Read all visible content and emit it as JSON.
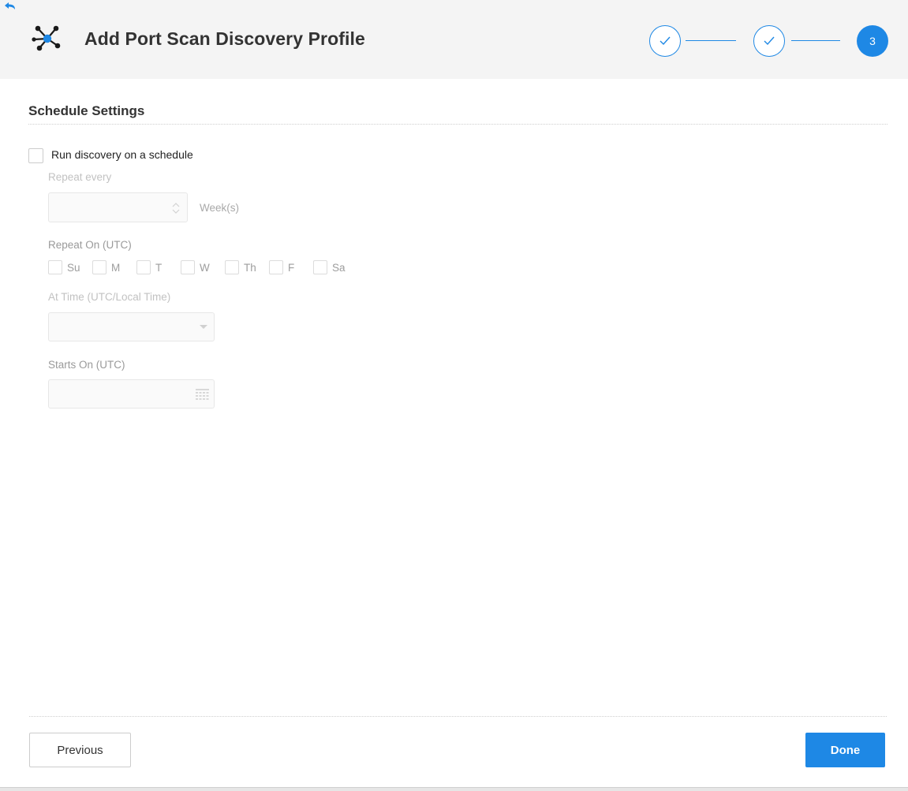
{
  "header": {
    "title": "Add Port Scan Discovery Profile",
    "back_icon": "back-arrow-icon",
    "logo_icon": "network-hub-icon"
  },
  "stepper": {
    "steps": [
      {
        "state": "done",
        "icon": "check-icon"
      },
      {
        "state": "done",
        "icon": "check-icon"
      },
      {
        "state": "active",
        "label": "3"
      }
    ]
  },
  "section": {
    "title": "Schedule Settings"
  },
  "schedule": {
    "checkbox_label": "Run discovery on a schedule",
    "checked": false,
    "repeat_every_label": "Repeat every",
    "repeat_every_value": "",
    "repeat_unit": "Week(s)",
    "repeat_on_label": "Repeat On (UTC)",
    "days": [
      "Su",
      "M",
      "T",
      "W",
      "Th",
      "F",
      "Sa"
    ],
    "at_time_label": "At Time (UTC/Local Time)",
    "at_time_value": "",
    "starts_on_label": "Starts On (UTC)",
    "starts_on_value": ""
  },
  "footer": {
    "previous_label": "Previous",
    "done_label": "Done"
  },
  "colors": {
    "accent": "#1e88e5",
    "header_bg": "#f4f4f4"
  }
}
